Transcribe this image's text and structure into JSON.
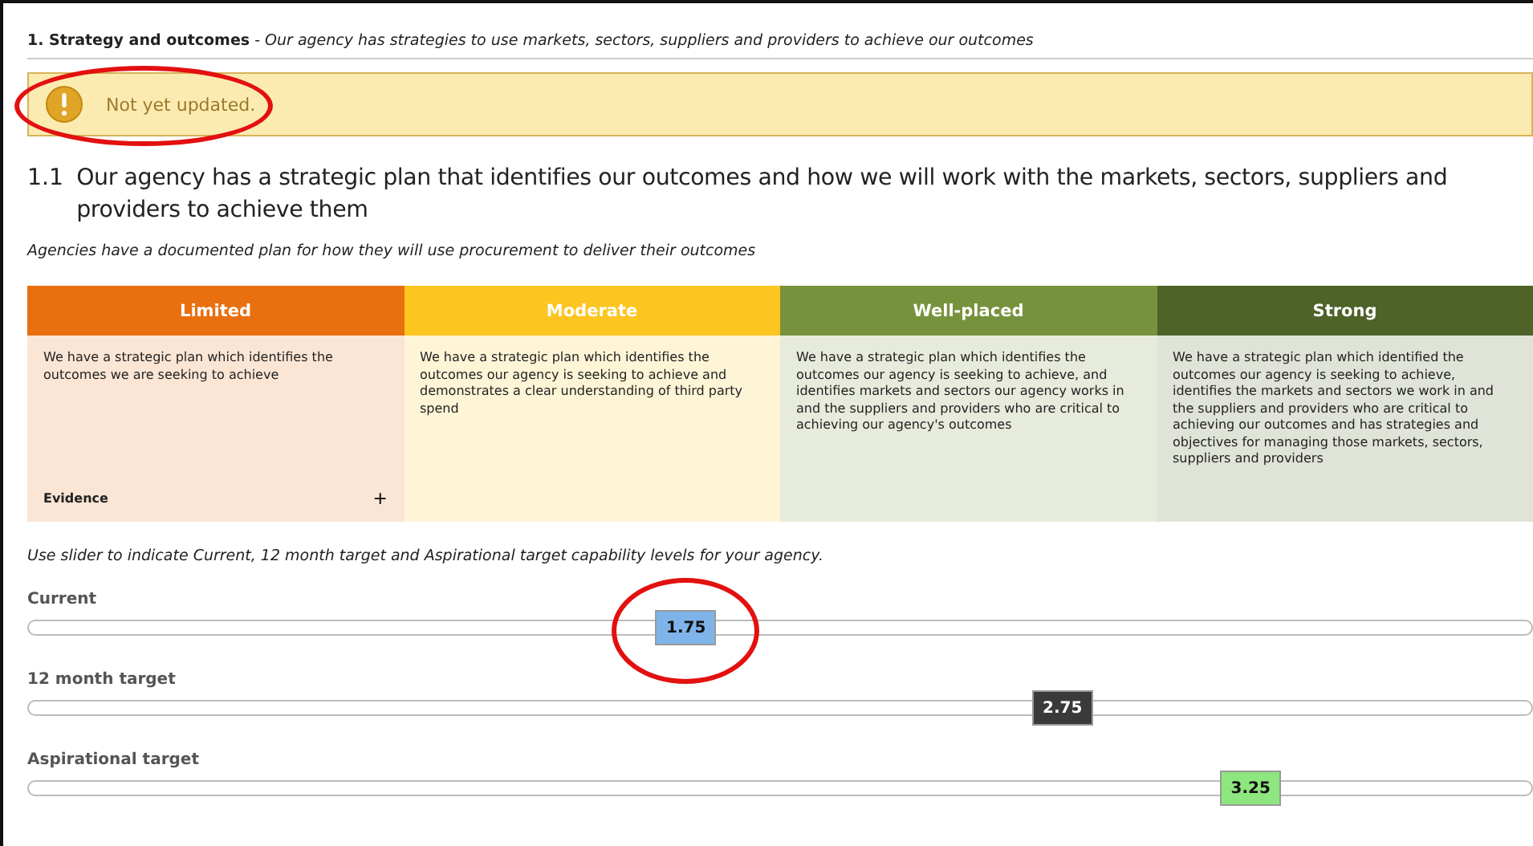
{
  "section": {
    "number_title": "1. Strategy and outcomes",
    "separator": "-",
    "subtitle": "Our agency has strategies to use markets, sectors, suppliers and providers to achieve our outcomes"
  },
  "notice": {
    "text": "Not yet updated.",
    "circled": true
  },
  "question": {
    "number": "1.1",
    "title": "Our agency has a strategic plan that identifies our outcomes and how we will work with the markets, sectors, suppliers and providers to achieve them",
    "description": "Agencies have a documented plan for how they will use procurement to deliver their outcomes"
  },
  "levels": [
    {
      "name": "Limited",
      "color": "#e8700f",
      "text": "We have a strategic plan which identifies the outcomes we are seeking to achieve",
      "evidence": {
        "label": "Evidence",
        "toggle": "+"
      }
    },
    {
      "name": "Moderate",
      "color": "#fcc520",
      "text": "We have a strategic plan which identifies the outcomes our agency is seeking to achieve and demonstrates a clear understanding of third party spend"
    },
    {
      "name": "Well-placed",
      "color": "#77923d",
      "text": "We have a strategic plan which identifies the outcomes our agency is seeking to achieve, and identifies markets and sectors our agency works in and the suppliers and providers who are critical to achieving our agency's outcomes"
    },
    {
      "name": "Strong",
      "color": "#4f6228",
      "text": "We have a strategic plan which identified the outcomes our agency is seeking to achieve, identifies the markets and sectors we work in and the suppliers and providers who are critical to achieving our outcomes and has strategies and objectives for managing those markets, sectors, suppliers and providers"
    }
  ],
  "slider_instruction": "Use slider to indicate Current, 12 month target and Aspirational target capability levels for your agency.",
  "sliders": [
    {
      "label": "Current",
      "value": "1.75",
      "level": 0.4375,
      "color": "#7eb4ea",
      "circled": true
    },
    {
      "label": "12 month target",
      "value": "2.75",
      "level": 0.6875,
      "color": "#3a3a3a",
      "circled": false
    },
    {
      "label": "Aspirational target",
      "value": "3.25",
      "level": 0.8125,
      "color": "#8de67e",
      "circled": false
    }
  ]
}
